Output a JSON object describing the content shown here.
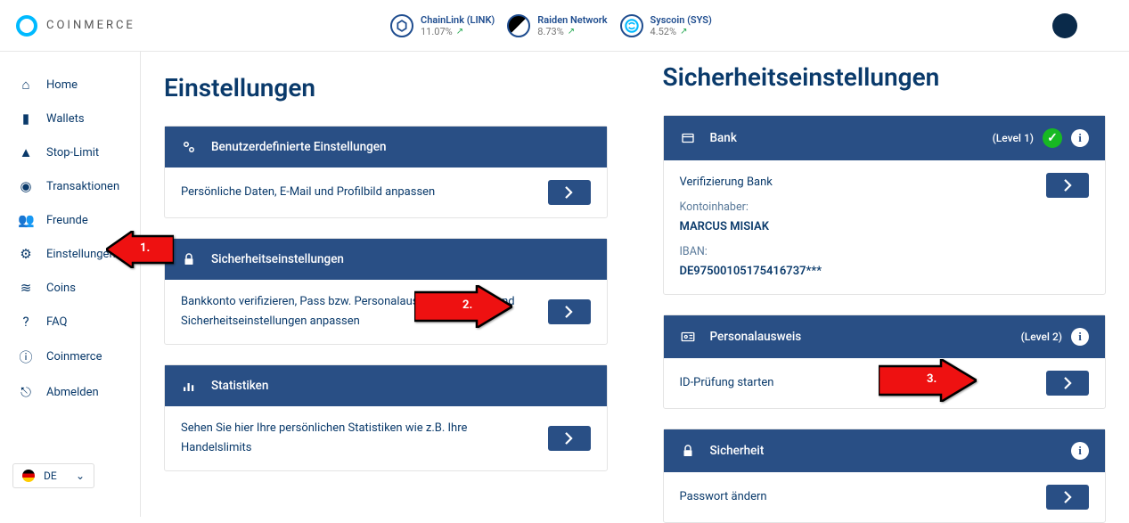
{
  "brand": "COINMERCE",
  "tickers": [
    {
      "name": "ChainLink (LINK)",
      "pct": "11.07%",
      "icon": "chainlink"
    },
    {
      "name": "Raiden Network",
      "pct": "8.73%",
      "icon": "raiden"
    },
    {
      "name": "Syscoin (SYS)",
      "pct": "4.52%",
      "icon": "syscoin"
    }
  ],
  "sidebar": {
    "items": [
      {
        "label": "Home",
        "icon": "home"
      },
      {
        "label": "Wallets",
        "icon": "wallet"
      },
      {
        "label": "Stop-Limit",
        "icon": "alert"
      },
      {
        "label": "Transaktionen",
        "icon": "swap"
      },
      {
        "label": "Freunde",
        "icon": "friends"
      },
      {
        "label": "Einstellungen",
        "icon": "gear"
      },
      {
        "label": "Coins",
        "icon": "coins"
      },
      {
        "label": "FAQ",
        "icon": "faq"
      },
      {
        "label": "Coinmerce",
        "icon": "info"
      },
      {
        "label": "Abmelden",
        "icon": "logout"
      }
    ],
    "lang": "DE"
  },
  "left": {
    "title": "Einstellungen",
    "panels": [
      {
        "header": "Benutzerdefinierte Einstellungen",
        "icon": "gears",
        "body": "Persönliche Daten, E-Mail und Profilbild anpassen"
      },
      {
        "header": "Sicherheitseinstellungen",
        "icon": "lock",
        "body": "Bankkonto verifizieren, Pass bzw. Personalausweis uploaden und Sicherheitseinstellungen anpassen"
      },
      {
        "header": "Statistiken",
        "icon": "stats",
        "body": "Sehen Sie hier Ihre persönlichen Statistiken wie z.B. Ihre Handelslimits"
      }
    ]
  },
  "right": {
    "title": "Sicherheitseinstellungen",
    "bank": {
      "header": "Bank",
      "level": "(Level 1)",
      "verified": true,
      "row_label": "Verifizierung Bank",
      "holder_label": "Kontoinhaber:",
      "holder": "MARCUS MISIAK",
      "iban_label": "IBAN:",
      "iban": "DE97500105175416737***"
    },
    "id": {
      "header": "Personalausweis",
      "level": "(Level 2)",
      "body": "ID-Prüfung starten"
    },
    "security": {
      "header": "Sicherheit",
      "body": "Passwort ändern"
    }
  },
  "annotations": {
    "a1": "1.",
    "a2": "2.",
    "a3": "3."
  }
}
